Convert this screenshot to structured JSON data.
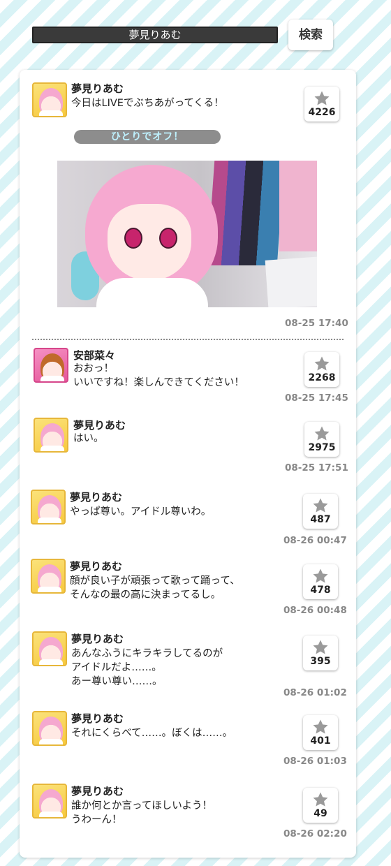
{
  "search": {
    "field_text": "夢見りあむ",
    "button_label": "検索"
  },
  "main_post": {
    "author": "夢見りあむ",
    "text": "今日はLIVEでぶちあがってくる！",
    "likes": "4226",
    "banner": "ひとりでオフ！",
    "time": "08-25 17:40"
  },
  "replies": [
    {
      "author": "安部菜々",
      "text": "おおっ！\nいいですね！楽しんできてください！",
      "likes": "2268",
      "time": "08-25 17:45"
    },
    {
      "author": "夢見りあむ",
      "text": "はい。",
      "likes": "2975",
      "time": "08-25 17:51"
    },
    {
      "author": "夢見りあむ",
      "text": "やっぱ尊い。アイドル尊いわ。",
      "likes": "487",
      "time": "08-26 00:47"
    },
    {
      "author": "夢見りあむ",
      "text": "顔が良い子が頑張って歌って踊って、\nそんなの最の高に決まってるし。",
      "likes": "478",
      "time": "08-26 00:48"
    },
    {
      "author": "夢見りあむ",
      "text": "あんなふうにキラキラしてるのが\nアイドルだよ……。\nあー尊い尊い……。",
      "likes": "395",
      "time": "08-26 01:02"
    },
    {
      "author": "夢見りあむ",
      "text": "それにくらべて……。ぼくは……。",
      "likes": "401",
      "time": "08-26 01:03"
    },
    {
      "author": "夢見りあむ",
      "text": "誰か何とか言ってほしいよう！\nうわーん！",
      "likes": "49",
      "time": "08-26 02:20"
    }
  ]
}
